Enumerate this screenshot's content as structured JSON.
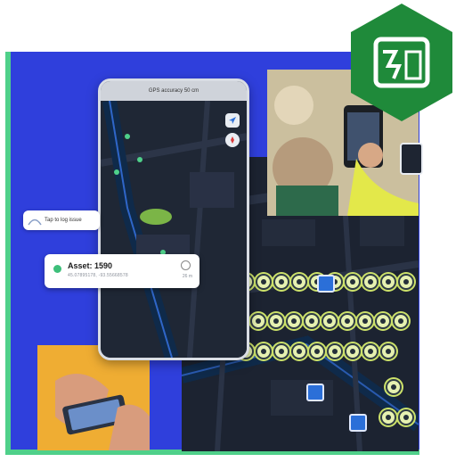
{
  "phone": {
    "gps_banner": "GPS accuracy 50 cm"
  },
  "speech_bubble": {
    "text": "Tap to log issue"
  },
  "asset_card": {
    "title": "Asset: 1590",
    "subtitle": "45.07895178, -93.55668578",
    "meta": "26 m"
  },
  "icons": {
    "badge": "map-logo-icon",
    "navigate": "navigation-arrow-icon",
    "compass": "compass-icon",
    "asset": "asset-dot-icon",
    "info": "info-icon"
  },
  "colors": {
    "panel_blue": "#2f3fdc",
    "accent_green": "#4fd08a",
    "badge_green": "#1f8a3a",
    "node_yellow": "#cde26a",
    "map_dark": "#1b2230"
  }
}
